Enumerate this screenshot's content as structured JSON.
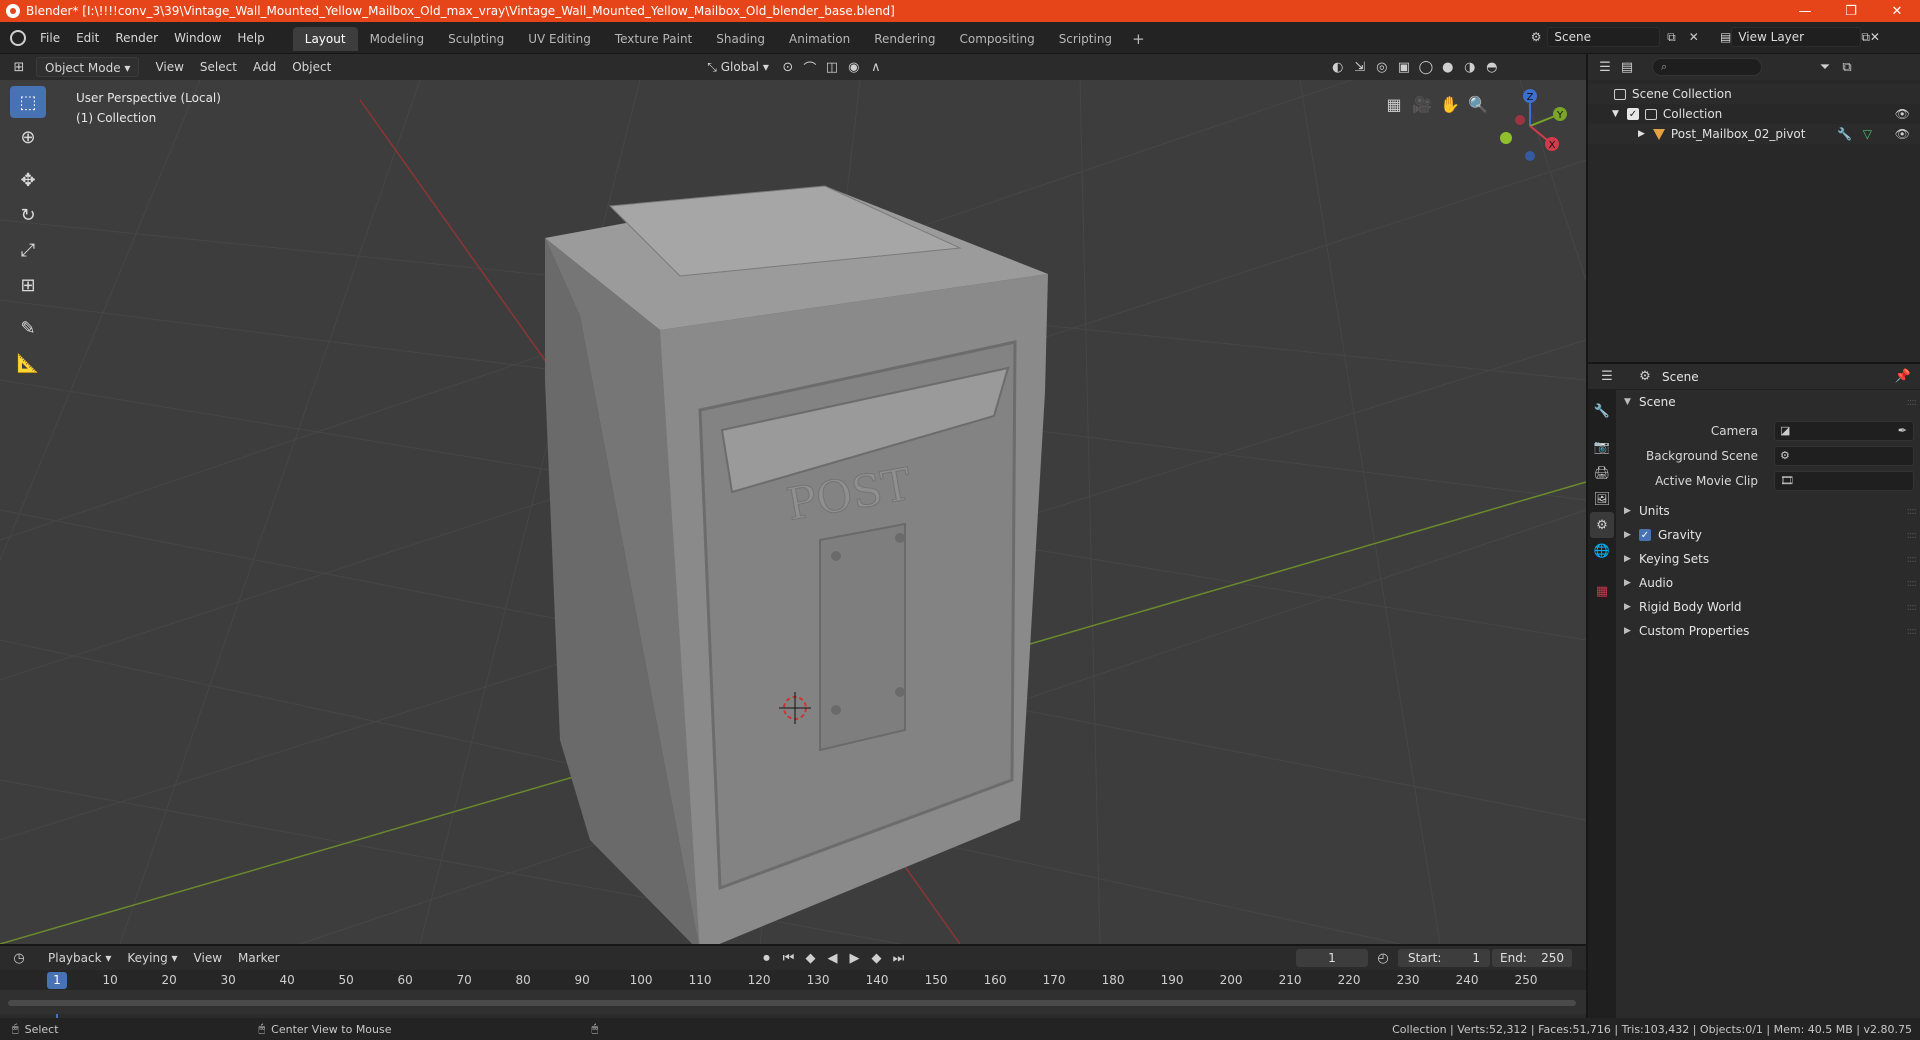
{
  "window": {
    "title": "Blender* [I:\\!!!!conv_3\\39\\Vintage_Wall_Mounted_Yellow_Mailbox_Old_max_vray\\Vintage_Wall_Mounted_Yellow_Mailbox_Old_blender_base.blend]",
    "minimize": "—",
    "maximize": "❐",
    "close": "✕"
  },
  "menu": [
    "File",
    "Edit",
    "Render",
    "Window",
    "Help"
  ],
  "workspaces": [
    "Layout",
    "Modeling",
    "Sculpting",
    "UV Editing",
    "Texture Paint",
    "Shading",
    "Animation",
    "Rendering",
    "Compositing",
    "Scripting"
  ],
  "workspace_add": "+",
  "scene_selector": "Scene",
  "view_layer": "View Layer",
  "viewport_header": {
    "mode": "Object Mode",
    "menus": [
      "View",
      "Select",
      "Add",
      "Object"
    ],
    "transform": "Global"
  },
  "viewport": {
    "perspective": "User Perspective (Local)",
    "collection": "(1) Collection",
    "model_label": "POST",
    "gizmo": {
      "z": "Z",
      "y": "Y",
      "x": "X"
    }
  },
  "outliner": {
    "search_placeholder": "⌕",
    "rows": [
      {
        "label": "Scene Collection"
      },
      {
        "label": "Collection"
      },
      {
        "label": "Post_Mailbox_02_pivot"
      }
    ]
  },
  "properties": {
    "header": "Scene",
    "scene_panel": "Scene",
    "fields": [
      {
        "label": "Camera"
      },
      {
        "label": "Background Scene"
      },
      {
        "label": "Active Movie Clip"
      }
    ],
    "panels": [
      "Units",
      "Gravity",
      "Keying Sets",
      "Audio",
      "Rigid Body World",
      "Custom Properties"
    ]
  },
  "timeline": {
    "menus": [
      "Playback",
      "Keying",
      "View",
      "Marker"
    ],
    "current_frame": "1",
    "start_label": "Start:",
    "start": "1",
    "end_label": "End:",
    "end": "250",
    "ticks": [
      "10",
      "20",
      "30",
      "40",
      "50",
      "60",
      "70",
      "80",
      "90",
      "100",
      "110",
      "120",
      "130",
      "140",
      "150",
      "160",
      "170",
      "180",
      "190",
      "200",
      "210",
      "220",
      "230",
      "240",
      "250"
    ],
    "playhead": "1"
  },
  "status": {
    "select": "Select",
    "center_view": "Center View to Mouse",
    "stats": "Collection | Verts:52,312 | Faces:51,716 | Tris:103,432 | Objects:0/1 | Mem: 40.5 MB | v2.80.75"
  }
}
